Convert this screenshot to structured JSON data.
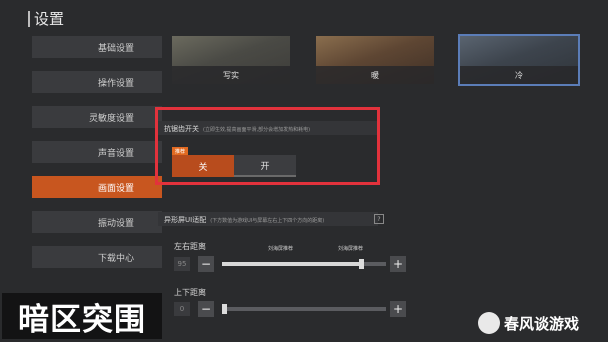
{
  "header": {
    "title": "设置"
  },
  "sidebar": {
    "items": [
      {
        "label": "基础设置"
      },
      {
        "label": "操作设置"
      },
      {
        "label": "灵敏度设置"
      },
      {
        "label": "声音设置"
      },
      {
        "label": "画面设置",
        "active": true
      },
      {
        "label": "振动设置"
      },
      {
        "label": "下载中心"
      }
    ]
  },
  "styles": {
    "items": [
      {
        "label": "写实"
      },
      {
        "label": "暖"
      },
      {
        "label": "冷",
        "selected": true
      }
    ]
  },
  "anti_aliasing": {
    "title": "抗锯齿开关",
    "hint": "(立即生效,提高画面平滑,部分会增加发热和耗电)",
    "tag": "推荐",
    "off_label": "关",
    "on_label": "开",
    "selected": "关"
  },
  "screen_fit": {
    "title": "异形屏UI适配",
    "hint": "(下方数值为游戏UI与屏幕左右上下四个方向的距离)",
    "help": "?"
  },
  "horizontal": {
    "label": "左右距离",
    "value": "95",
    "tick1": "刘海屏推荐",
    "tick2": "刘海屏推荐",
    "minus": "−",
    "plus": "+",
    "fill": 0.85
  },
  "vertical": {
    "label": "上下距离",
    "value": "0",
    "minus": "−",
    "plus": "+",
    "fill": 0.0
  },
  "watermarks": {
    "left": "暗区突围",
    "right": "春风谈游戏"
  },
  "colors": {
    "accent": "#c8561f",
    "highlight_box": "#e2323c",
    "selected_outline": "#5b7db8"
  }
}
